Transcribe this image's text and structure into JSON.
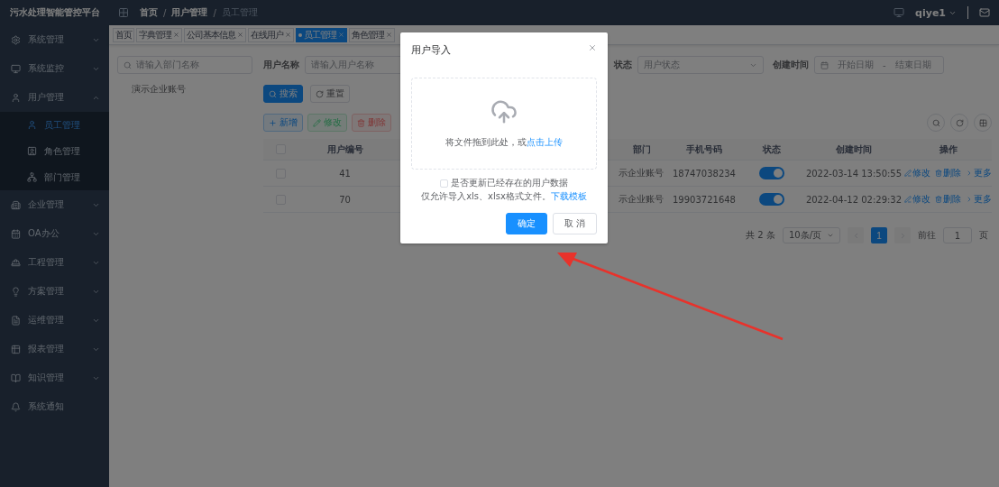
{
  "sidebar": {
    "title": "污水处理智能管控平台",
    "items": [
      {
        "label": "系统管理",
        "kind": "group",
        "expanded": false
      },
      {
        "label": "系统监控",
        "kind": "group",
        "expanded": false
      },
      {
        "label": "用户管理",
        "kind": "group",
        "expanded": true,
        "children": [
          {
            "label": "员工管理",
            "selected": true
          },
          {
            "label": "角色管理",
            "selected": false
          },
          {
            "label": "部门管理",
            "selected": false
          }
        ]
      },
      {
        "label": "企业管理",
        "kind": "group",
        "expanded": false
      },
      {
        "label": "OA办公",
        "kind": "group",
        "expanded": false
      },
      {
        "label": "工程管理",
        "kind": "group",
        "expanded": false
      },
      {
        "label": "方案管理",
        "kind": "group",
        "expanded": false
      },
      {
        "label": "运维管理",
        "kind": "group",
        "expanded": false
      },
      {
        "label": "报表管理",
        "kind": "group",
        "expanded": false
      },
      {
        "label": "知识管理",
        "kind": "group",
        "expanded": false
      },
      {
        "label": "系统通知",
        "kind": "link"
      }
    ]
  },
  "header": {
    "breadcrumb": [
      "首页",
      "用户管理",
      "员工管理"
    ],
    "separator": "/",
    "user": "qiye1"
  },
  "tabs": [
    {
      "label": "首页",
      "closable": false,
      "selected": false
    },
    {
      "label": "字典管理",
      "closable": true,
      "selected": false
    },
    {
      "label": "公司基本信息",
      "closable": true,
      "selected": false
    },
    {
      "label": "在线用户",
      "closable": true,
      "selected": false
    },
    {
      "label": "员工管理",
      "closable": true,
      "selected": true
    },
    {
      "label": "角色管理",
      "closable": true,
      "selected": false
    }
  ],
  "dept_tree": {
    "placeholder": "请输入部门名称",
    "nodes": [
      "演示企业账号"
    ]
  },
  "filters": [
    {
      "label": "用户名称",
      "kind": "text",
      "placeholder": "请输入用户名称"
    },
    {
      "label": "状态",
      "kind": "select",
      "placeholder": "用户状态"
    },
    {
      "label": "创建时间",
      "kind": "daterange",
      "start_placeholder": "开始日期",
      "separator": "-",
      "end_placeholder": "结束日期"
    }
  ],
  "search_buttons": [
    {
      "label": "搜索",
      "kind": "primary"
    },
    {
      "label": "重置",
      "kind": "default"
    }
  ],
  "toolbar": [
    {
      "label": "新增",
      "kind": "add",
      "disabled": false
    },
    {
      "label": "修改",
      "kind": "edit",
      "disabled": true
    },
    {
      "label": "删除",
      "kind": "delete",
      "disabled": true
    }
  ],
  "table": {
    "all_checked": false,
    "columns": [
      "用户编号",
      "部门",
      "手机号码",
      "状态",
      "创建时间",
      "操作"
    ],
    "rows": [
      {
        "checked": false,
        "id": "41",
        "dept": "示企业账号",
        "phone": "18747038234",
        "on": true,
        "created": "2022-03-14 13:50:55",
        "actions": [
          "修改",
          "删除",
          "更多"
        ]
      },
      {
        "checked": false,
        "id": "70",
        "dept": "示企业账号",
        "phone": "19903721648",
        "on": true,
        "created": "2022-04-12 02:29:32",
        "actions": [
          "修改",
          "删除",
          "更多"
        ]
      }
    ]
  },
  "pagination": {
    "total": "共 2 条",
    "page_size": "10条/页",
    "pages": [
      {
        "label": "1",
        "selected": true
      }
    ],
    "goto_label": "前往",
    "goto_value": "1",
    "goto_suffix": "页"
  },
  "dialog": {
    "title": "用户导入",
    "upload_text": "将文件拖到此处，或",
    "upload_link": "点击上传",
    "update_option": {
      "label": "是否更新已经存在的用户数据",
      "checked": false
    },
    "hint": "仅允许导入xls、xlsx格式文件。",
    "template_link": "下载模板",
    "buttons": [
      {
        "label": "确定",
        "kind": "primary"
      },
      {
        "label": "取 消",
        "kind": "default"
      }
    ]
  }
}
